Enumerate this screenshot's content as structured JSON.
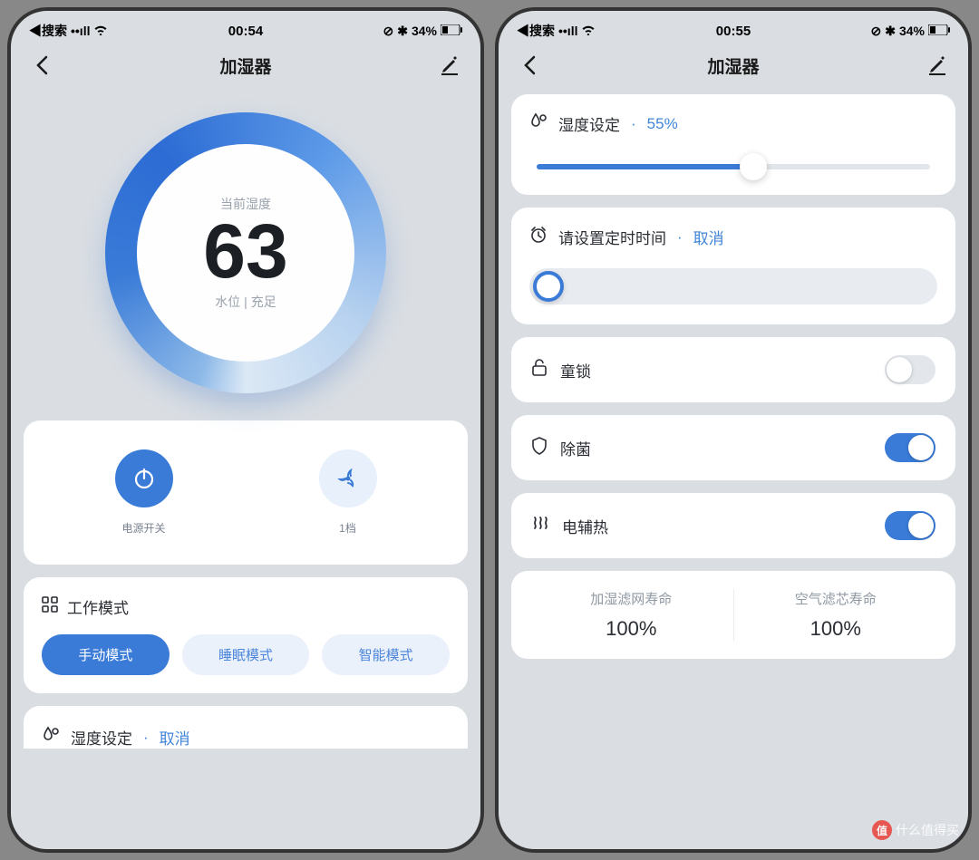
{
  "left": {
    "status": {
      "carrier": "◀搜索",
      "signal": "••ıll",
      "wifi": "📶",
      "time": "00:54",
      "battery_icon": "🔋",
      "battery_pct": "34%",
      "bt": "✱"
    },
    "header": {
      "title": "加湿器"
    },
    "gauge": {
      "label": "当前湿度",
      "value": "63",
      "status": "水位 | 充足"
    },
    "controls": {
      "power_label": "电源开关",
      "speed_label": "1档"
    },
    "mode": {
      "title": "工作模式",
      "opts": [
        "手动模式",
        "睡眠模式",
        "智能模式"
      ]
    },
    "humidity_peek": {
      "label": "湿度设定",
      "action": "取消"
    }
  },
  "right": {
    "status": {
      "carrier": "◀搜索",
      "signal": "••ıll",
      "wifi": "📶",
      "time": "00:55",
      "battery_icon": "🔋",
      "battery_pct": "34%",
      "bt": "✱"
    },
    "header": {
      "title": "加湿器"
    },
    "humidity": {
      "label": "湿度设定",
      "value": "55%",
      "slider_pct": 55
    },
    "timer": {
      "label": "请设置定时时间",
      "action": "取消"
    },
    "switches": {
      "childlock": {
        "label": "童锁",
        "on": false
      },
      "sterilize": {
        "label": "除菌",
        "on": true
      },
      "heater": {
        "label": "电辅热",
        "on": true
      }
    },
    "filters": {
      "humid": {
        "label": "加湿滤网寿命",
        "value": "100%"
      },
      "air": {
        "label": "空气滤芯寿命",
        "value": "100%"
      }
    }
  },
  "watermark": "什么值得买"
}
